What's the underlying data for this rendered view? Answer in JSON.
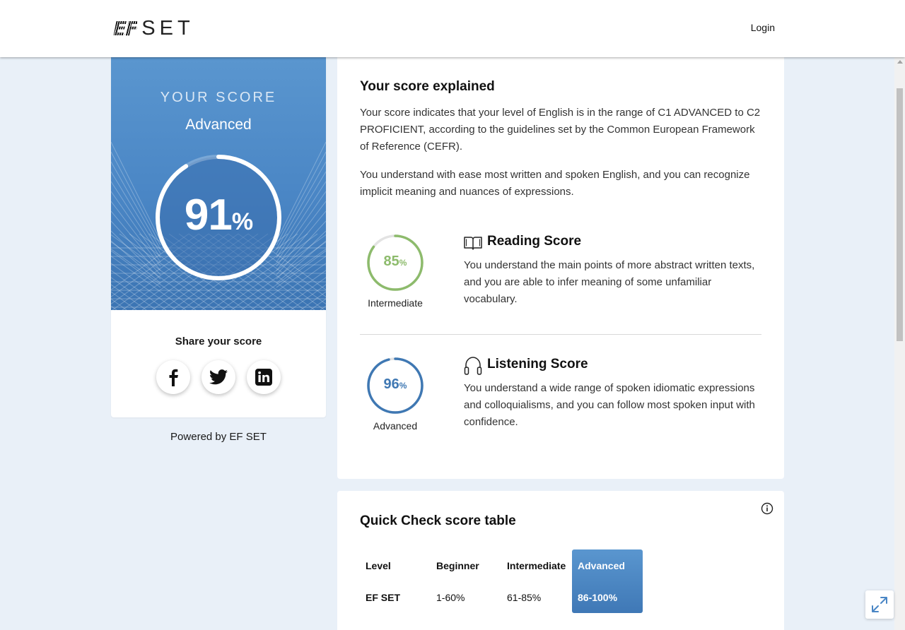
{
  "header": {
    "logo_ef": "EF",
    "logo_set": "SET",
    "login_label": "Login"
  },
  "score_card": {
    "heading": "YOUR SCORE",
    "level": "Advanced",
    "score_value": "91",
    "score_unit": "%",
    "score_fraction": 0.91,
    "share_label": "Share your score",
    "social": [
      "facebook-icon",
      "twitter-icon",
      "linkedin-icon"
    ]
  },
  "powered_by": "Powered by EF SET",
  "explained": {
    "title": "Your score explained",
    "paragraph1": "Your score indicates that your level of English is in the range of C1 ADVANCED to C2 PROFICIENT, according to the guidelines set by the Common European Framework of Reference (CEFR).",
    "paragraph2": "You understand with ease most written and spoken English, and you can recognize implicit meaning and nuances of expressions.",
    "reading": {
      "value": "85",
      "unit": "%",
      "fraction": 0.85,
      "level": "Intermediate",
      "title": "Reading Score",
      "icon": "book-icon",
      "color": "#8dbb6c",
      "text": "You understand the main points of more abstract written texts, and you are able to infer meaning of some unfamiliar vocabulary."
    },
    "listening": {
      "value": "96",
      "unit": "%",
      "fraction": 0.96,
      "level": "Advanced",
      "title": "Listening Score",
      "icon": "headphones-icon",
      "color": "#3f78b3",
      "text": "You understand a wide range of spoken idiomatic expressions and colloquialisms, and you can follow most spoken input with confidence."
    }
  },
  "score_table": {
    "title": "Quick Check score table",
    "headers": [
      "Level",
      "Beginner",
      "Intermediate",
      "Advanced"
    ],
    "row": [
      "EF SET",
      "1-60%",
      "61-85%",
      "86-100%"
    ],
    "highlight_color": "#4a86c5"
  },
  "colors": {
    "accent": "#4a86c5",
    "background": "#e9f0f8"
  }
}
